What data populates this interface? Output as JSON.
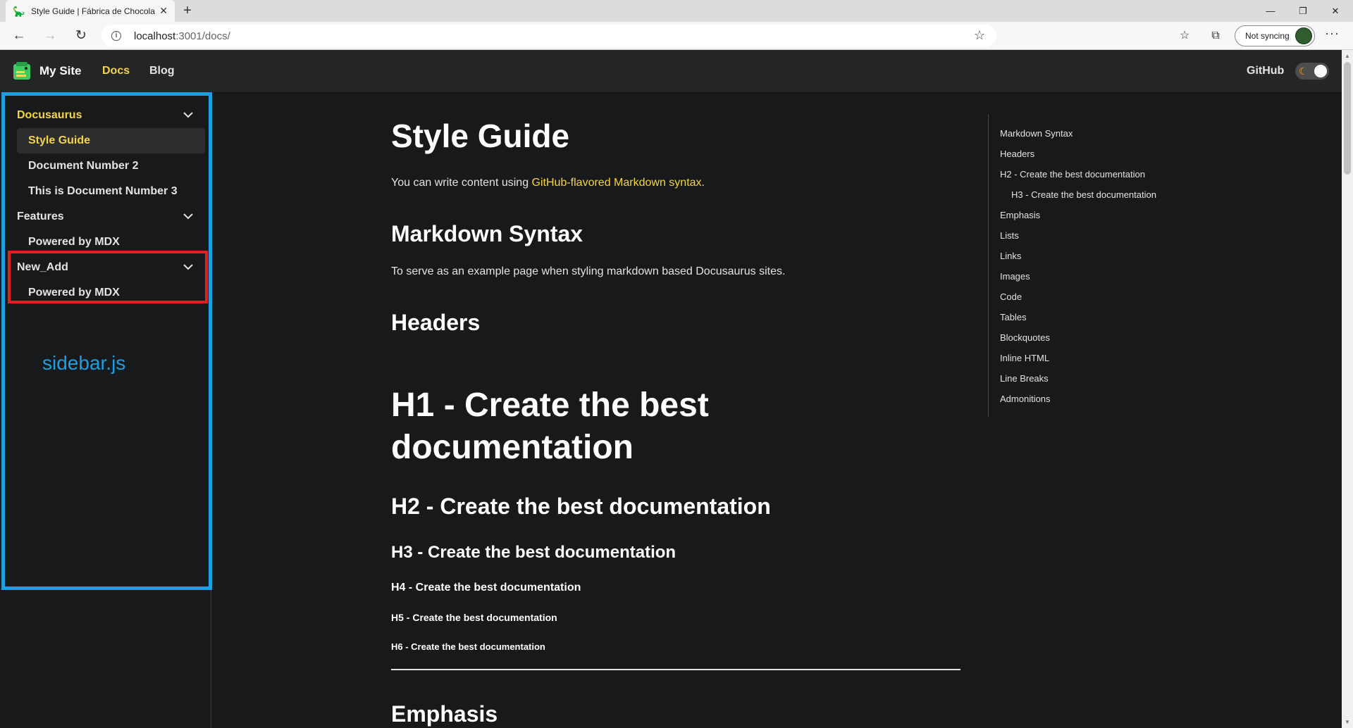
{
  "browser": {
    "tab_title": "Style Guide | Fábrica de Chocolat",
    "url_host": "localhost",
    "url_path": ":3001/docs/",
    "sync_label": "Not syncing",
    "window_controls": {
      "minimize": "—",
      "restore": "❐",
      "close": "✕"
    },
    "icons": [
      "back-icon",
      "forward-icon",
      "reload-icon",
      "info-icon",
      "star-icon",
      "favorites-icon",
      "collections-icon",
      "more-icon"
    ]
  },
  "site": {
    "brand": "My Site",
    "nav": {
      "docs": "Docs",
      "blog": "Blog",
      "github": "GitHub"
    },
    "accent": "#f5d547"
  },
  "sidebar": {
    "items": [
      {
        "label": "Docusaurus",
        "kind": "category",
        "active": true
      },
      {
        "label": "Style Guide",
        "kind": "link",
        "current": true
      },
      {
        "label": "Document Number 2",
        "kind": "link"
      },
      {
        "label": "This is Document Number 3",
        "kind": "link"
      },
      {
        "label": "Features",
        "kind": "category"
      },
      {
        "label": "Powered by MDX",
        "kind": "link"
      },
      {
        "label": "New_Add",
        "kind": "category"
      },
      {
        "label": "Powered by MDX",
        "kind": "link"
      }
    ],
    "caption": "sidebar.js",
    "frame_color": "#1c9fe0",
    "highlight_color": "#e02020"
  },
  "main": {
    "title": "Style Guide",
    "intro_text": "You can write content using ",
    "intro_link": "GitHub-flavored Markdown syntax",
    "intro_end": ".",
    "markdown_syntax_heading": "Markdown Syntax",
    "markdown_syntax_text": "To serve as an example page when styling markdown based Docusaurus sites.",
    "headers_heading": "Headers",
    "h1": "H1 - Create the best documentation",
    "h2": "H2 - Create the best documentation",
    "h3": "H3 - Create the best documentation",
    "h4": "H4 - Create the best documentation",
    "h5": "H5 - Create the best documentation",
    "h6": "H6 - Create the best documentation",
    "emphasis_heading": "Emphasis"
  },
  "toc": [
    {
      "label": "Markdown Syntax"
    },
    {
      "label": "Headers"
    },
    {
      "label": "H2 - Create the best documentation"
    },
    {
      "label": "H3 - Create the best documentation",
      "sub": true
    },
    {
      "label": "Emphasis"
    },
    {
      "label": "Lists"
    },
    {
      "label": "Links"
    },
    {
      "label": "Images"
    },
    {
      "label": "Code"
    },
    {
      "label": "Tables"
    },
    {
      "label": "Blockquotes"
    },
    {
      "label": "Inline HTML"
    },
    {
      "label": "Line Breaks"
    },
    {
      "label": "Admonitions"
    }
  ]
}
